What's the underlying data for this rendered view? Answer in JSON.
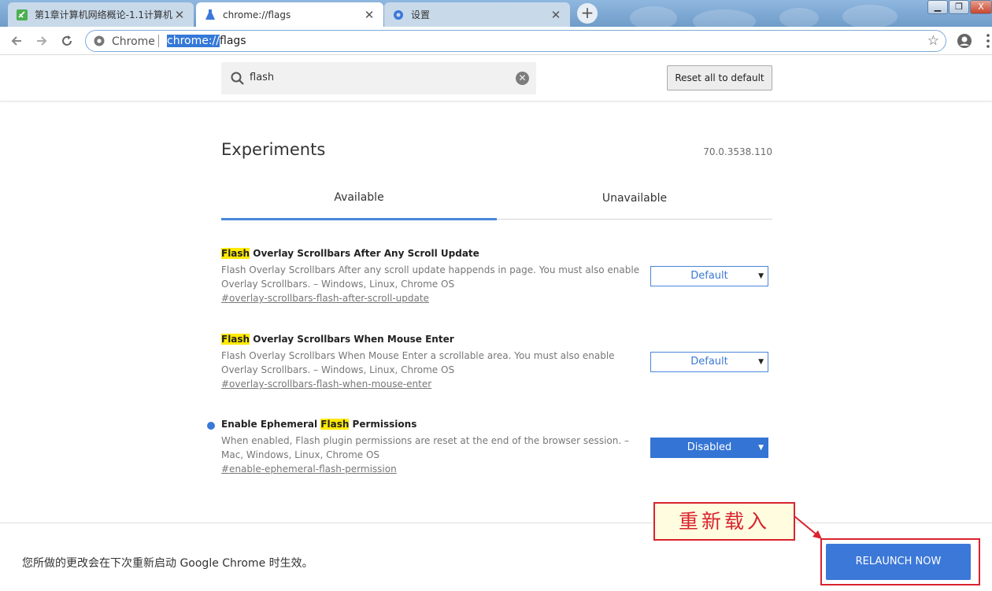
{
  "browser": {
    "tabs": [
      {
        "title": "第1章计算机网络概论-1.1计算机"
      },
      {
        "title": "chrome://flags"
      },
      {
        "title": "设置"
      }
    ],
    "new_tab_symbol": "+",
    "close_symbol": "✕",
    "window_controls": {
      "minimize": "▁",
      "maximize": "❐",
      "close": "X"
    }
  },
  "omnibox": {
    "prefix": "Chrome",
    "url_selected": "chrome://",
    "url_rest": "flags"
  },
  "search": {
    "value": "flash",
    "clear_symbol": "✕"
  },
  "reset_button": "Reset all to default",
  "experiments": {
    "title": "Experiments",
    "version": "70.0.3538.110",
    "tabs": {
      "available": "Available",
      "unavailable": "Unavailable"
    },
    "items": [
      {
        "name_highlight": "Flash",
        "name_rest": " Overlay Scrollbars After Any Scroll Update",
        "description": "Flash Overlay Scrollbars After any scroll update happends in page. You must also enable Overlay Scrollbars. – Windows, Linux, Chrome OS",
        "link": "#overlay-scrollbars-flash-after-scroll-update",
        "value": "Default"
      },
      {
        "name_highlight": "Flash",
        "name_rest": " Overlay Scrollbars When Mouse Enter",
        "description": "Flash Overlay Scrollbars When Mouse Enter a scrollable area. You must also enable Overlay Scrollbars. – Windows, Linux, Chrome OS",
        "link": "#overlay-scrollbars-flash-when-mouse-enter",
        "value": "Default"
      },
      {
        "name_prefix": "Enable Ephemeral ",
        "name_highlight": "Flash",
        "name_rest": " Permissions",
        "description": "When enabled, Flash plugin permissions are reset at the end of the browser session. – Mac, Windows, Linux, Chrome OS",
        "link": "#enable-ephemeral-flash-permission",
        "value": "Disabled"
      }
    ],
    "select_arrow": "▼"
  },
  "bottom_bar": {
    "message": "您所做的更改会在下次重新启动 Google Chrome 时生效。",
    "relaunch_button": "RELAUNCH NOW"
  },
  "annotation": {
    "callout_text": "重新载入",
    "color": "#d9232e"
  },
  "colors": {
    "accent": "#3c78d8",
    "highlight": "#ffea00"
  }
}
